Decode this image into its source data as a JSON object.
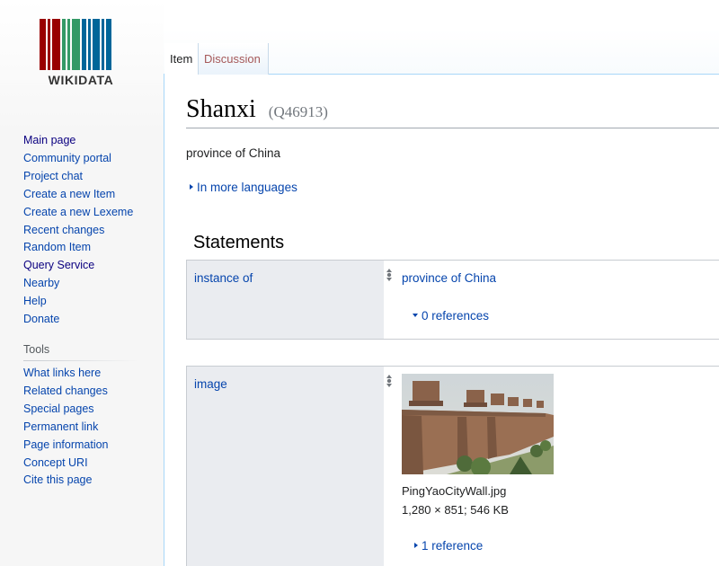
{
  "logo": {
    "wordmark": "WIKIDATA",
    "bar_colors": [
      "#990000",
      "#ffffff",
      "#990000",
      "#990000",
      "#ffffff",
      "#339966",
      "#339966",
      "#ffffff",
      "#006699",
      "#ffffff",
      "#006699"
    ]
  },
  "sidebar": {
    "nav": [
      {
        "label": "Main page"
      },
      {
        "label": "Community portal"
      },
      {
        "label": "Project chat"
      },
      {
        "label": "Create a new Item"
      },
      {
        "label": "Create a new Lexeme"
      },
      {
        "label": "Recent changes"
      },
      {
        "label": "Random Item"
      },
      {
        "label": "Query Service"
      },
      {
        "label": "Nearby"
      },
      {
        "label": "Help"
      },
      {
        "label": "Donate"
      }
    ],
    "tools_heading": "Tools",
    "tools": [
      {
        "label": "What links here"
      },
      {
        "label": "Related changes"
      },
      {
        "label": "Special pages"
      },
      {
        "label": "Permanent link"
      },
      {
        "label": "Page information"
      },
      {
        "label": "Concept URI"
      },
      {
        "label": "Cite this page"
      }
    ]
  },
  "tabs": {
    "item": "Item",
    "discussion": "Discussion"
  },
  "page": {
    "title": "Shanxi",
    "qid": "(Q46913)",
    "description": "province of China",
    "more_languages": "In more languages",
    "statements_heading": "Statements"
  },
  "statements": [
    {
      "property": "instance of",
      "value": "province of China",
      "references": "0 references"
    },
    {
      "property": "image",
      "file_name": "PingYaoCityWall.jpg",
      "file_meta": "1,280 × 851; 546 KB",
      "references": "1 reference"
    }
  ],
  "colors": {
    "link": "#0645ad",
    "sidebar_bg": "#f6f6f6",
    "property_bg": "#eaecf0",
    "discussion_tab": "#a55858"
  }
}
